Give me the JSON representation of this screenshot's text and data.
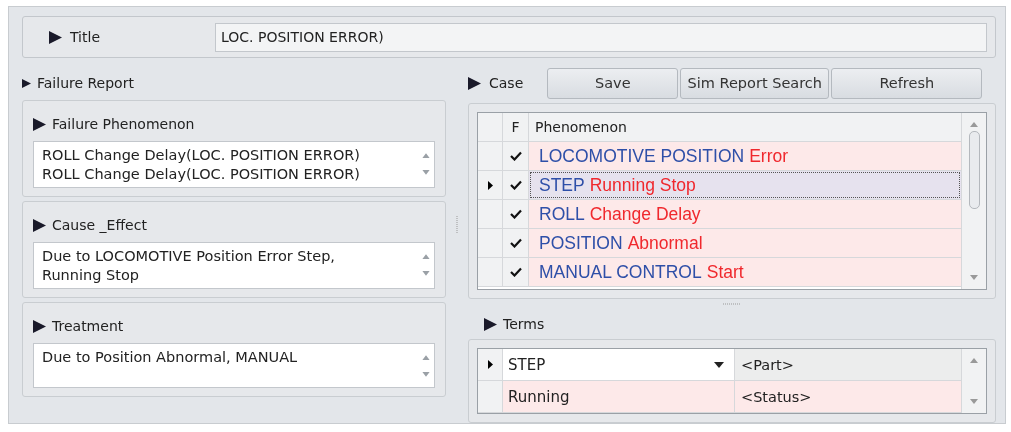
{
  "title": {
    "label": "Title",
    "value": "LOC. POSITION ERROR)"
  },
  "failure_report": {
    "label": "Failure Report",
    "sections": [
      {
        "label": "Failure Phenomenon",
        "lines": [
          "ROLL Change Delay(LOC. POSITION ERROR)",
          "ROLL Change Delay(LOC. POSITION ERROR)"
        ]
      },
      {
        "label": "Cause _Effect",
        "lines": [
          "Due to LOCOMOTIVE Position Error Step,",
          "Running Stop"
        ]
      },
      {
        "label": "Treatment",
        "lines": [
          "Due to Position Abnormal, MANUAL"
        ]
      }
    ]
  },
  "case": {
    "label": "Case",
    "buttons": [
      "Save",
      "Sim Report Search",
      "Refresh"
    ],
    "columns": [
      "F",
      "Phenomenon"
    ],
    "rows": [
      {
        "checked": true,
        "selected": false,
        "subject": "LOCOMOTIVE POSITION",
        "state": "Error"
      },
      {
        "checked": true,
        "selected": true,
        "subject": "STEP",
        "state": "Running Stop"
      },
      {
        "checked": true,
        "selected": false,
        "subject": "ROLL",
        "state": "Change Delay"
      },
      {
        "checked": true,
        "selected": false,
        "subject": "POSITION",
        "state": "Abnormal"
      },
      {
        "checked": true,
        "selected": false,
        "subject": "MANUAL CONTROL",
        "state": "Start"
      }
    ]
  },
  "terms": {
    "label": "Terms",
    "rows": [
      {
        "selected": true,
        "value": "STEP",
        "category": "<Part>"
      },
      {
        "selected": false,
        "value": "Running",
        "category": "<Status>"
      }
    ]
  }
}
